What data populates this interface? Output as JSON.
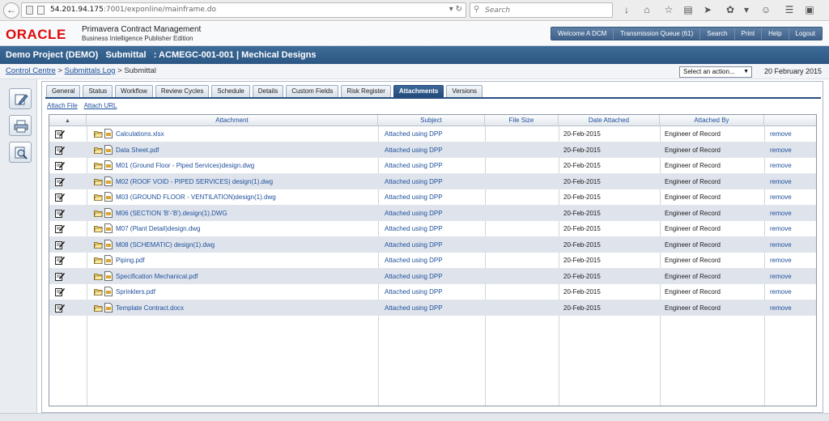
{
  "browser": {
    "url_host": "54.201.94.175",
    "url_rest": ":7001/exponline/mainframe.do",
    "search_placeholder": "Search"
  },
  "brand": {
    "logo": "ORACLE",
    "product_line1": "Primavera Contract Management",
    "product_line2": "Business Intelligence Publisher Edition"
  },
  "topnav": [
    "Welcome A DCM",
    "Transmission Queue (61)",
    "Search",
    "Print",
    "Help",
    "Logout"
  ],
  "project_title": "Demo Project (DEMO)   Submittal   : ACMEGC-001-001 | Mechical Designs",
  "breadcrumb": {
    "item1": "Control Centre",
    "item2": "Submittals Log",
    "current": "Submittal",
    "separator": ">"
  },
  "action_select": "Select an action...",
  "date": "20 February 2015",
  "tabs": [
    "General",
    "Status",
    "Workflow",
    "Review Cycles",
    "Schedule",
    "Details",
    "Custom Fields",
    "Risk Register",
    "Attachments",
    "Versions"
  ],
  "active_tab": "Attachments",
  "links": {
    "attach_file": "Attach File",
    "attach_url": "Attach URL"
  },
  "table": {
    "sort_glyph": "▲",
    "headers": {
      "attachment": "Attachment",
      "subject": "Subject",
      "file_size": "File Size",
      "date_attached": "Date Attached",
      "attached_by": "Attached By"
    },
    "rows": [
      {
        "name": "Calculations.xlsx",
        "subject": "Attached using DPP",
        "size": "",
        "date": "20-Feb-2015",
        "by": "Engineer of Record",
        "action": "remove"
      },
      {
        "name": "Data Sheet.pdf",
        "subject": "Attached using DPP",
        "size": "",
        "date": "20-Feb-2015",
        "by": "Engineer of Record",
        "action": "remove"
      },
      {
        "name": "M01 (Ground Floor - Piped Services)design.dwg",
        "subject": "Attached using DPP",
        "size": "",
        "date": "20-Feb-2015",
        "by": "Engineer of Record",
        "action": "remove"
      },
      {
        "name": "M02 (ROOF VOID - PIPED SERVICES) design(1).dwg",
        "subject": "Attached using DPP",
        "size": "",
        "date": "20-Feb-2015",
        "by": "Engineer of Record",
        "action": "remove"
      },
      {
        "name": "M03 (GROUND FLOOR - VENTILATION)design(1).dwg",
        "subject": "Attached using DPP",
        "size": "",
        "date": "20-Feb-2015",
        "by": "Engineer of Record",
        "action": "remove"
      },
      {
        "name": "M06 (SECTION 'B'-'B').design(1).DWG",
        "subject": "Attached using DPP",
        "size": "",
        "date": "20-Feb-2015",
        "by": "Engineer of Record",
        "action": "remove"
      },
      {
        "name": "M07 (Plant Detail)design.dwg",
        "subject": "Attached using DPP",
        "size": "",
        "date": "20-Feb-2015",
        "by": "Engineer of Record",
        "action": "remove"
      },
      {
        "name": "M08 (SCHEMATIC) design(1).dwg",
        "subject": "Attached using DPP",
        "size": "",
        "date": "20-Feb-2015",
        "by": "Engineer of Record",
        "action": "remove"
      },
      {
        "name": "Piping.pdf",
        "subject": "Attached using DPP",
        "size": "",
        "date": "20-Feb-2015",
        "by": "Engineer of Record",
        "action": "remove"
      },
      {
        "name": "Specification Mechanical.pdf",
        "subject": "Attached using DPP",
        "size": "",
        "date": "20-Feb-2015",
        "by": "Engineer of Record",
        "action": "remove"
      },
      {
        "name": "Sprinklers.pdf",
        "subject": "Attached using DPP",
        "size": "",
        "date": "20-Feb-2015",
        "by": "Engineer of Record",
        "action": "remove"
      },
      {
        "name": "Template Contract.docx",
        "subject": "Attached using DPP",
        "size": "",
        "date": "20-Feb-2015",
        "by": "Engineer of Record",
        "action": "remove"
      }
    ]
  },
  "colors": {
    "brand_red": "#e10a0a",
    "header_blue": "#2c5784",
    "link_blue": "#1d4f9a",
    "row_alt": "#dfe4ec"
  },
  "icons": {
    "left_tools": [
      "edit-icon",
      "print-icon",
      "magnify-icon"
    ],
    "row_icons": [
      "edit-icon",
      "folder-open-icon",
      "file-icon"
    ]
  }
}
